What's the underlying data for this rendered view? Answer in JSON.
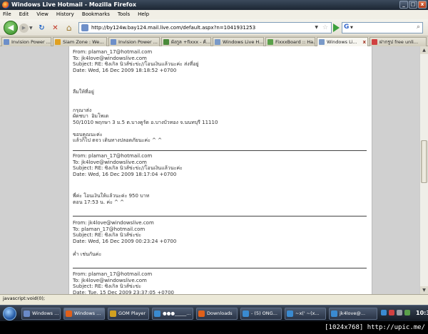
{
  "window": {
    "title": "Windows Live Hotmail - Mozilla Firefox",
    "controls": [
      "_",
      "□",
      "x"
    ]
  },
  "menu": [
    "File",
    "Edit",
    "View",
    "History",
    "Bookmarks",
    "Tools",
    "Help"
  ],
  "nav": {
    "url": "http://by124w.bay124.mail.live.com/default.aspx?n=1041931253",
    "search_engine": "G",
    "back_glyph": "◀",
    "forward_glyph": "▶",
    "reload_glyph": "↻",
    "stop_glyph": "✕",
    "home_glyph": "⌂"
  },
  "tabs": [
    {
      "label": "Invision Power ...",
      "color": "#6d8fc9",
      "active": false
    },
    {
      "label": "Siam Zone : We...",
      "color": "#e0a020",
      "active": false
    },
    {
      "label": "Invision Power ...",
      "color": "#6d8fc9",
      "active": false
    },
    {
      "label": "ผังกูล +fixxx - ค้...",
      "color": "#4a8a3a",
      "active": false
    },
    {
      "label": "Windows Live H...",
      "color": "#7a9ac8",
      "active": false
    },
    {
      "label": "FixxxBoard :: Ha...",
      "color": "#5aa04a",
      "active": false
    },
    {
      "label": "Windows Li...",
      "color": "#7a9ac8",
      "active": true
    },
    {
      "label": "ฝากรูป free unli...",
      "color": "#d04040",
      "active": false
    }
  ],
  "messages": {
    "block1": "From: plaman_17@hotmail.com\nTo: jk4love@windowslive.com\nSubject: RE: ซิงเกิล นิวส์ข่ะข่ะ//โอนเงินแล้วนะค่ะ ส่งที่อยู่\nDate: Wed, 16 Dec 2009 18:18:52 +0700",
    "block2": "ลืมให้ที่อยู่\n\n\nกรุณาส่ง\nผัดชบา  อิมโพเด\n50/1010 พฤกษา 3 ม.5 ต.บางคูรัด อ.บางบัวทอง จ.นนทบุรี 11110\n\nขอบคุณนะค่ะ\nแล้วก็ไป ตจว เดินทางปลอดภัยนะค่ะ ^ ^",
    "block3": "From: plaman_17@hotmail.com\nTo: jk4love@windowslive.com\nSubject: RE: ซิงเกิล นิวส์ข่ะข่ะ//โอนเงินแล้วนะค่ะ\nDate: Wed, 16 Dec 2009 18:17:04 +0700",
    "block4": "พี่ค่ะ โอนเงินให้แล้วนะค่ะ 950 บาท\nตอน 17:53 น. ค่ะ ^ ^",
    "block5": "From: jk4love@windowslive.com\nTo: plaman_17@hotmail.com\nSubject: RE: ซิงเกิล นิวส์ข่ะข่ะ\nDate: Wed, 16 Dec 2009 00:23:24 +0700",
    "block6": "ค่ำ เช่นกันค่ะ",
    "block7": "From: plaman_17@hotmail.com\nTo: jk4love@windowslive.com\nSubject: RE: ซิงเกิล นิวส์ข่ะข่ะ\nDate: Tue, 15 Dec 2009 23:37:05 +0700"
  },
  "status": {
    "text": "javascript:void(0);"
  },
  "taskbar": {
    "tasks": [
      {
        "label": "Windows ...",
        "color": "#6a8ac8",
        "active": false
      },
      {
        "label": "Windows ...",
        "color": "#e0601a",
        "active": true
      },
      {
        "label": "GOM Player",
        "color": "#d0a020",
        "active": false
      },
      {
        "label": "●●●_____...",
        "color": "#3a8ad0",
        "active": false
      },
      {
        "label": "Downloads",
        "color": "#e0601a",
        "active": false
      },
      {
        "label": "- (5) ONG...",
        "color": "#3a8ad0",
        "active": false
      },
      {
        "label": "~x(' ~(x...",
        "color": "#3a8ad0",
        "active": false
      },
      {
        "label": "jk4love@...",
        "color": "#3a8ad0",
        "active": false
      }
    ],
    "clock": "10:36"
  },
  "banner": {
    "text": "[1024x768] http://upic.me/"
  }
}
